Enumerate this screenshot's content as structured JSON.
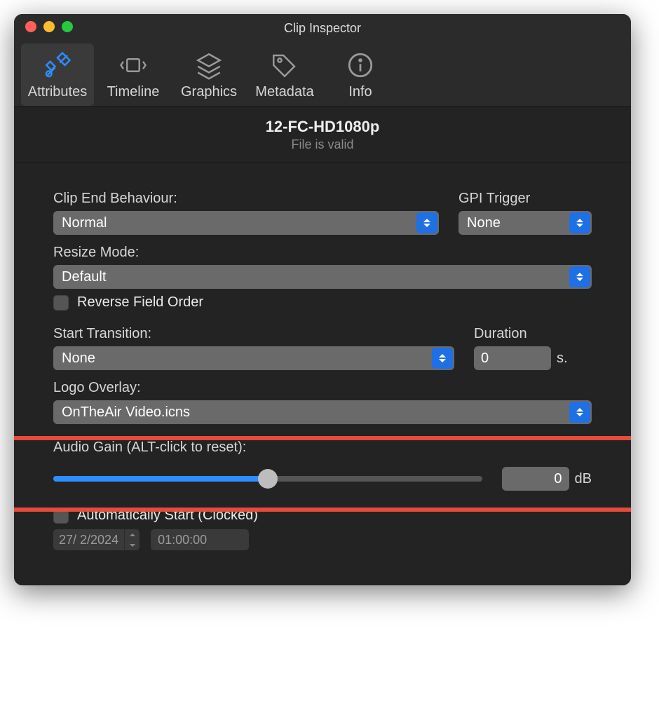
{
  "window": {
    "title": "Clip Inspector"
  },
  "tabs": [
    {
      "label": "Attributes",
      "icon": "tools"
    },
    {
      "label": "Timeline",
      "icon": "timeline"
    },
    {
      "label": "Graphics",
      "icon": "layers"
    },
    {
      "label": "Metadata",
      "icon": "tag"
    },
    {
      "label": "Info",
      "icon": "info"
    }
  ],
  "clip": {
    "name": "12-FC-HD1080p",
    "status": "File is valid"
  },
  "fields": {
    "clip_end_behaviour_label": "Clip End Behaviour:",
    "clip_end_behaviour_value": "Normal",
    "gpi_trigger_label": "GPI Trigger",
    "gpi_trigger_value": "None",
    "resize_mode_label": "Resize Mode:",
    "resize_mode_value": "Default",
    "reverse_field_order_label": "Reverse Field Order",
    "start_transition_label": "Start Transition:",
    "start_transition_value": "None",
    "duration_label": "Duration",
    "duration_value": "0",
    "duration_unit": "s.",
    "logo_overlay_label": "Logo Overlay:",
    "logo_overlay_value": "OnTheAir Video.icns",
    "audio_gain_label": "Audio Gain (ALT-click to reset):",
    "audio_gain_value": "0",
    "audio_gain_unit": "dB",
    "auto_start_label": "Automatically Start (Clocked)",
    "auto_start_date": "27/  2/2024",
    "auto_start_time": "01:00:00"
  }
}
